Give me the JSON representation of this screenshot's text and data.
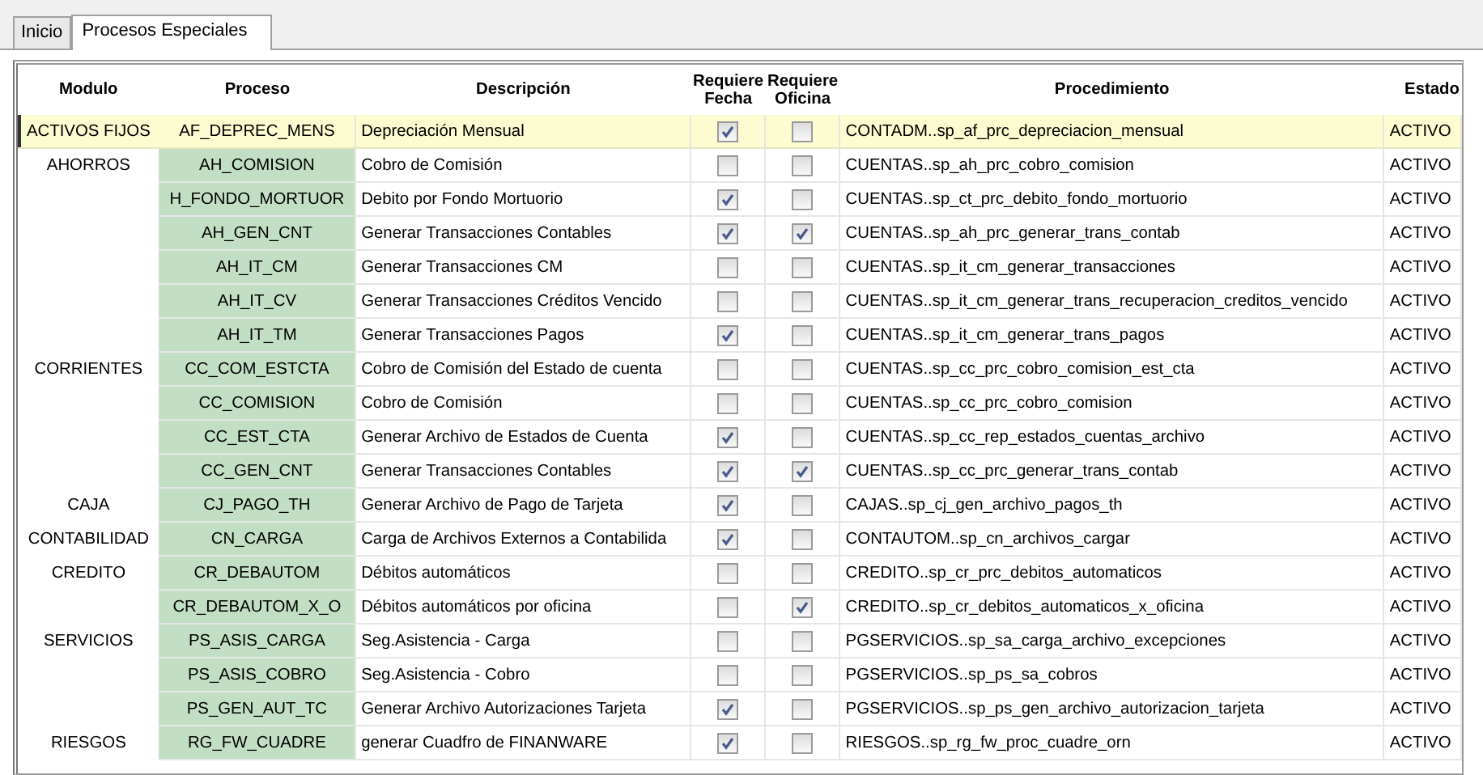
{
  "tabs": [
    {
      "label": "Inicio",
      "selected": false
    },
    {
      "label": "Procesos Especiales",
      "selected": true
    }
  ],
  "table": {
    "columns": [
      "Modulo",
      "Proceso",
      "Descripción",
      "Requiere Fecha",
      "Requiere Oficina",
      "Procedimiento",
      "Estado"
    ],
    "rows": [
      {
        "modulo": "ACTIVOS FIJOS",
        "proceso": "AF_DEPREC_MENS",
        "descripcion": "Depreciación Mensual",
        "requiere_fecha": true,
        "requiere_oficina": false,
        "procedimiento": "CONTADM..sp_af_prc_depreciacion_mensual",
        "estado": "ACTIVO",
        "selected": true
      },
      {
        "modulo": "AHORROS",
        "proceso": "AH_COMISION",
        "descripcion": "Cobro de Comisión",
        "requiere_fecha": false,
        "requiere_oficina": false,
        "procedimiento": "CUENTAS..sp_ah_prc_cobro_comision",
        "estado": "ACTIVO",
        "selected": false
      },
      {
        "proceso": "H_FONDO_MORTUOR",
        "descripcion": "Debito por Fondo Mortuorio",
        "requiere_fecha": true,
        "requiere_oficina": false,
        "procedimiento": "CUENTAS..sp_ct_prc_debito_fondo_mortuorio",
        "estado": "ACTIVO",
        "selected": false
      },
      {
        "proceso": "AH_GEN_CNT",
        "descripcion": "Generar Transacciones Contables",
        "requiere_fecha": true,
        "requiere_oficina": true,
        "procedimiento": "CUENTAS..sp_ah_prc_generar_trans_contab",
        "estado": "ACTIVO",
        "selected": false
      },
      {
        "proceso": "AH_IT_CM",
        "descripcion": "Generar Transacciones CM",
        "requiere_fecha": false,
        "requiere_oficina": false,
        "procedimiento": "CUENTAS..sp_it_cm_generar_transacciones",
        "estado": "ACTIVO",
        "selected": false
      },
      {
        "proceso": "AH_IT_CV",
        "descripcion": "Generar Transacciones Créditos Vencido",
        "requiere_fecha": false,
        "requiere_oficina": false,
        "procedimiento": "CUENTAS..sp_it_cm_generar_trans_recuperacion_creditos_vencido",
        "estado": "ACTIVO",
        "selected": false
      },
      {
        "proceso": "AH_IT_TM",
        "descripcion": "Generar Transacciones Pagos",
        "requiere_fecha": true,
        "requiere_oficina": false,
        "procedimiento": "CUENTAS..sp_it_cm_generar_trans_pagos",
        "estado": "ACTIVO",
        "selected": false
      },
      {
        "modulo": "CORRIENTES",
        "proceso": "CC_COM_ESTCTA",
        "descripcion": "Cobro de Comisión del Estado de cuenta",
        "requiere_fecha": false,
        "requiere_oficina": false,
        "procedimiento": "CUENTAS..sp_cc_prc_cobro_comision_est_cta",
        "estado": "ACTIVO",
        "selected": false
      },
      {
        "proceso": "CC_COMISION",
        "descripcion": "Cobro de Comisión",
        "requiere_fecha": false,
        "requiere_oficina": false,
        "procedimiento": "CUENTAS..sp_cc_prc_cobro_comision",
        "estado": "ACTIVO",
        "selected": false
      },
      {
        "proceso": "CC_EST_CTA",
        "descripcion": "Generar Archivo de Estados de Cuenta",
        "requiere_fecha": true,
        "requiere_oficina": false,
        "procedimiento": "CUENTAS..sp_cc_rep_estados_cuentas_archivo",
        "estado": "ACTIVO",
        "selected": false
      },
      {
        "proceso": "CC_GEN_CNT",
        "descripcion": "Generar Transacciones Contables",
        "requiere_fecha": true,
        "requiere_oficina": true,
        "procedimiento": "CUENTAS..sp_cc_prc_generar_trans_contab",
        "estado": "ACTIVO",
        "selected": false
      },
      {
        "modulo": "CAJA",
        "proceso": "CJ_PAGO_TH",
        "descripcion": "Generar Archivo de Pago de Tarjeta",
        "requiere_fecha": true,
        "requiere_oficina": false,
        "procedimiento": "CAJAS..sp_cj_gen_archivo_pagos_th",
        "estado": "ACTIVO",
        "selected": false
      },
      {
        "modulo": "CONTABILIDAD",
        "proceso": "CN_CARGA",
        "descripcion": "Carga de Archivos Externos a Contabilida",
        "requiere_fecha": true,
        "requiere_oficina": false,
        "procedimiento": "CONTAUTOM..sp_cn_archivos_cargar",
        "estado": "ACTIVO",
        "selected": false
      },
      {
        "modulo": "CREDITO",
        "proceso": "CR_DEBAUTOM",
        "descripcion": "Débitos automáticos",
        "requiere_fecha": false,
        "requiere_oficina": false,
        "procedimiento": "CREDITO..sp_cr_prc_debitos_automaticos",
        "estado": "ACTIVO",
        "selected": false
      },
      {
        "proceso": "CR_DEBAUTOM_X_O",
        "descripcion": "Débitos automáticos por oficina",
        "requiere_fecha": false,
        "requiere_oficina": true,
        "procedimiento": "CREDITO..sp_cr_debitos_automaticos_x_oficina",
        "estado": "ACTIVO",
        "selected": false
      },
      {
        "modulo": "SERVICIOS",
        "proceso": "PS_ASIS_CARGA",
        "descripcion": "Seg.Asistencia - Carga",
        "requiere_fecha": false,
        "requiere_oficina": false,
        "procedimiento": "PGSERVICIOS..sp_sa_carga_archivo_excepciones",
        "estado": "ACTIVO",
        "selected": false
      },
      {
        "proceso": "PS_ASIS_COBRO",
        "descripcion": "Seg.Asistencia - Cobro",
        "requiere_fecha": false,
        "requiere_oficina": false,
        "procedimiento": "PGSERVICIOS..sp_ps_sa_cobros",
        "estado": "ACTIVO",
        "selected": false
      },
      {
        "proceso": "PS_GEN_AUT_TC",
        "descripcion": "Generar Archivo Autorizaciones Tarjeta",
        "requiere_fecha": true,
        "requiere_oficina": false,
        "procedimiento": "PGSERVICIOS..sp_ps_gen_archivo_autorizacion_tarjeta",
        "estado": "ACTIVO",
        "selected": false
      },
      {
        "modulo": "RIESGOS",
        "proceso": "RG_FW_CUADRE",
        "descripcion": "generar Cuadfro de FINANWARE",
        "requiere_fecha": true,
        "requiere_oficina": false,
        "procedimiento": "RIESGOS..sp_rg_fw_proc_cuadre_orn",
        "estado": "ACTIVO",
        "selected": false
      }
    ]
  }
}
